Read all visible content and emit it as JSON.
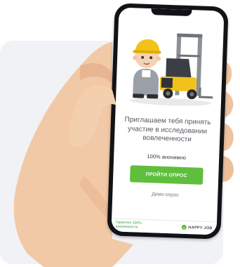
{
  "survey": {
    "invite_text": "Приглашаем тебя принять участие в исследовании вовлеченности",
    "anonymity": "100% анонимно",
    "start_button": "ПРОЙТИ ОПРОС",
    "demo_link": "Демо-опрос"
  },
  "footer": {
    "guarantee": "Гарантия 100% анонимности",
    "brand": "HAPPY JOB"
  },
  "icons": {
    "brand_logo": "happy-job-logo-icon",
    "illustration": "worker-with-forklift-illustration"
  },
  "colors": {
    "accent_green": "#5fbe3c",
    "phone_body": "#121317",
    "card_background": "#f1f2f6"
  }
}
